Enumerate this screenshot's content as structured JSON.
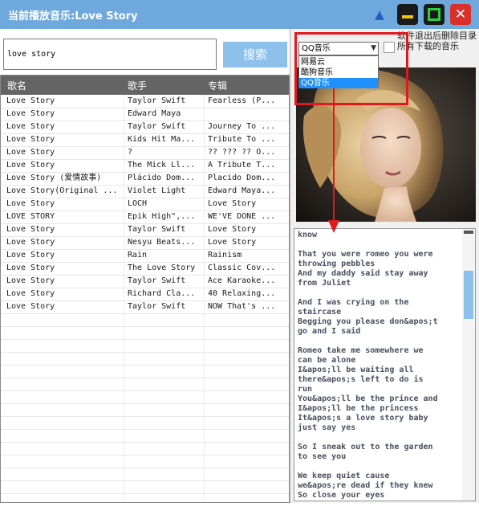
{
  "window": {
    "title": "当前播放音乐:Love Story"
  },
  "search": {
    "query": "love story",
    "button_label": "搜索"
  },
  "table": {
    "headers": [
      "歌名",
      "歌手",
      "专辑"
    ],
    "rows": [
      [
        "Love Story",
        "Taylor Swift",
        "Fearless (P..."
      ],
      [
        "Love Story",
        "Edward Maya",
        ""
      ],
      [
        "Love Story",
        "Taylor Swift",
        "Journey To ..."
      ],
      [
        "Love Story",
        "Kids Hit Ma...",
        "Tribute To ..."
      ],
      [
        "Love Story",
        "?",
        "?? ??? ?? O..."
      ],
      [
        "Love Story",
        "The Mick Ll...",
        "A Tribute T..."
      ],
      [
        "Love Story (爱情故事)",
        "Plácido Dom...",
        "Placido Dom..."
      ],
      [
        "Love Story(Original ...",
        "Violet Light",
        "Edward Maya..."
      ],
      [
        "Love Story",
        "LOCH",
        "Love Story"
      ],
      [
        "LOVE STORY",
        "Epik High\",...",
        "WE'VE DONE ..."
      ],
      [
        "Love Story",
        "Taylor Swift",
        "Love Story"
      ],
      [
        "Love Story",
        "Nesyu Beats...",
        "Love Story"
      ],
      [
        "Love Story",
        "Rain",
        "Rainism"
      ],
      [
        "Love Story",
        "The Love Story",
        "Classic Cov..."
      ],
      [
        "Love Story",
        "Taylor Swift",
        "Ace Karaoke..."
      ],
      [
        "Love Story",
        "Richard Cla...",
        "40 Relaxing..."
      ],
      [
        "Love Story",
        "Taylor Swift",
        "NOW That's ..."
      ]
    ]
  },
  "source": {
    "selected": "QQ音乐",
    "options": [
      "网易云",
      "酷狗音乐",
      "QQ音乐"
    ],
    "delete_label": "软件退出后删除目录所有下载的音乐"
  },
  "lyrics": {
    "text": "know\n\nThat you were romeo you were\nthrowing pebbles\nAnd my daddy said stay away\nfrom Juliet\n\nAnd I was crying on the\nstaircase\nBegging you please don&apos;t\ngo and I said\n\nRomeo take me somewhere we\ncan be alone\nI&apos;ll be waiting all\nthere&apos;s left to do is\nrun\nYou&apos;ll be the prince and\nI&apos;ll be the princess\nIt&apos;s a love story baby\njust say yes\n\nSo I sneak out to the garden\nto see you\n\nWe keep quiet cause\nwe&apos;re dead if they knew\nSo close your eyes"
  },
  "colors": {
    "titlebar": "#6fa8dc",
    "search_button": "#8ec0ec",
    "header_row": "#646464",
    "highlight": "#e0191f",
    "selected_option": "#1e90ff",
    "lyrics_text": "#4a4f60"
  },
  "icons": [
    "skin-icon",
    "minimize-icon",
    "maximize-icon",
    "close-icon",
    "dropdown-arrow-icon"
  ]
}
